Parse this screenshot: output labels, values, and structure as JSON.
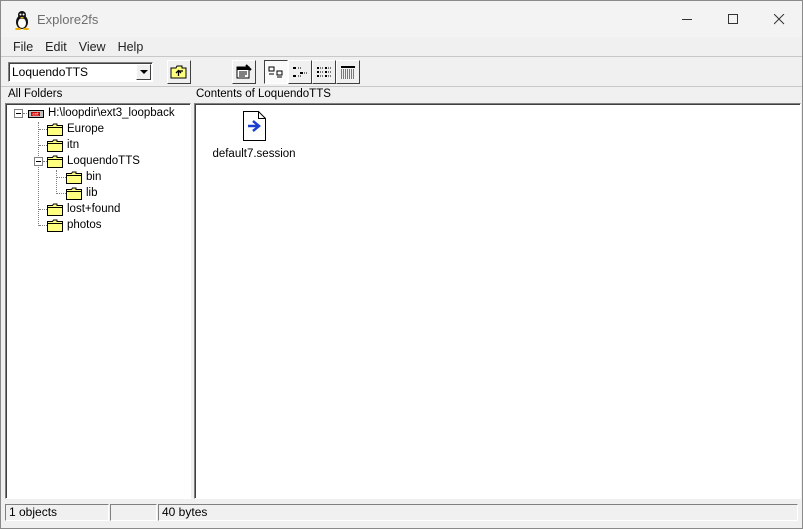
{
  "window": {
    "title": "Explore2fs"
  },
  "menu": {
    "items": [
      "File",
      "Edit",
      "View",
      "Help"
    ]
  },
  "toolbar": {
    "folder_combo_value": "LoquendoTTS"
  },
  "left_pane": {
    "header": "All Folders",
    "root": "H:\\loopdir\\ext3_loopback",
    "folders": [
      "Europe",
      "itn",
      "LoquendoTTS",
      "bin",
      "lib",
      "lost+found",
      "photos"
    ]
  },
  "right_pane": {
    "header": "Contents of LoquendoTTS",
    "files": [
      {
        "name": "default7.session",
        "icon": "session-file-icon"
      }
    ]
  },
  "status": {
    "objects": "1 objects",
    "size": "40 bytes"
  },
  "colors": {
    "folder": "#ffff80",
    "window_bg": "#f0f0f0",
    "arrow": "#1a3fd0"
  }
}
